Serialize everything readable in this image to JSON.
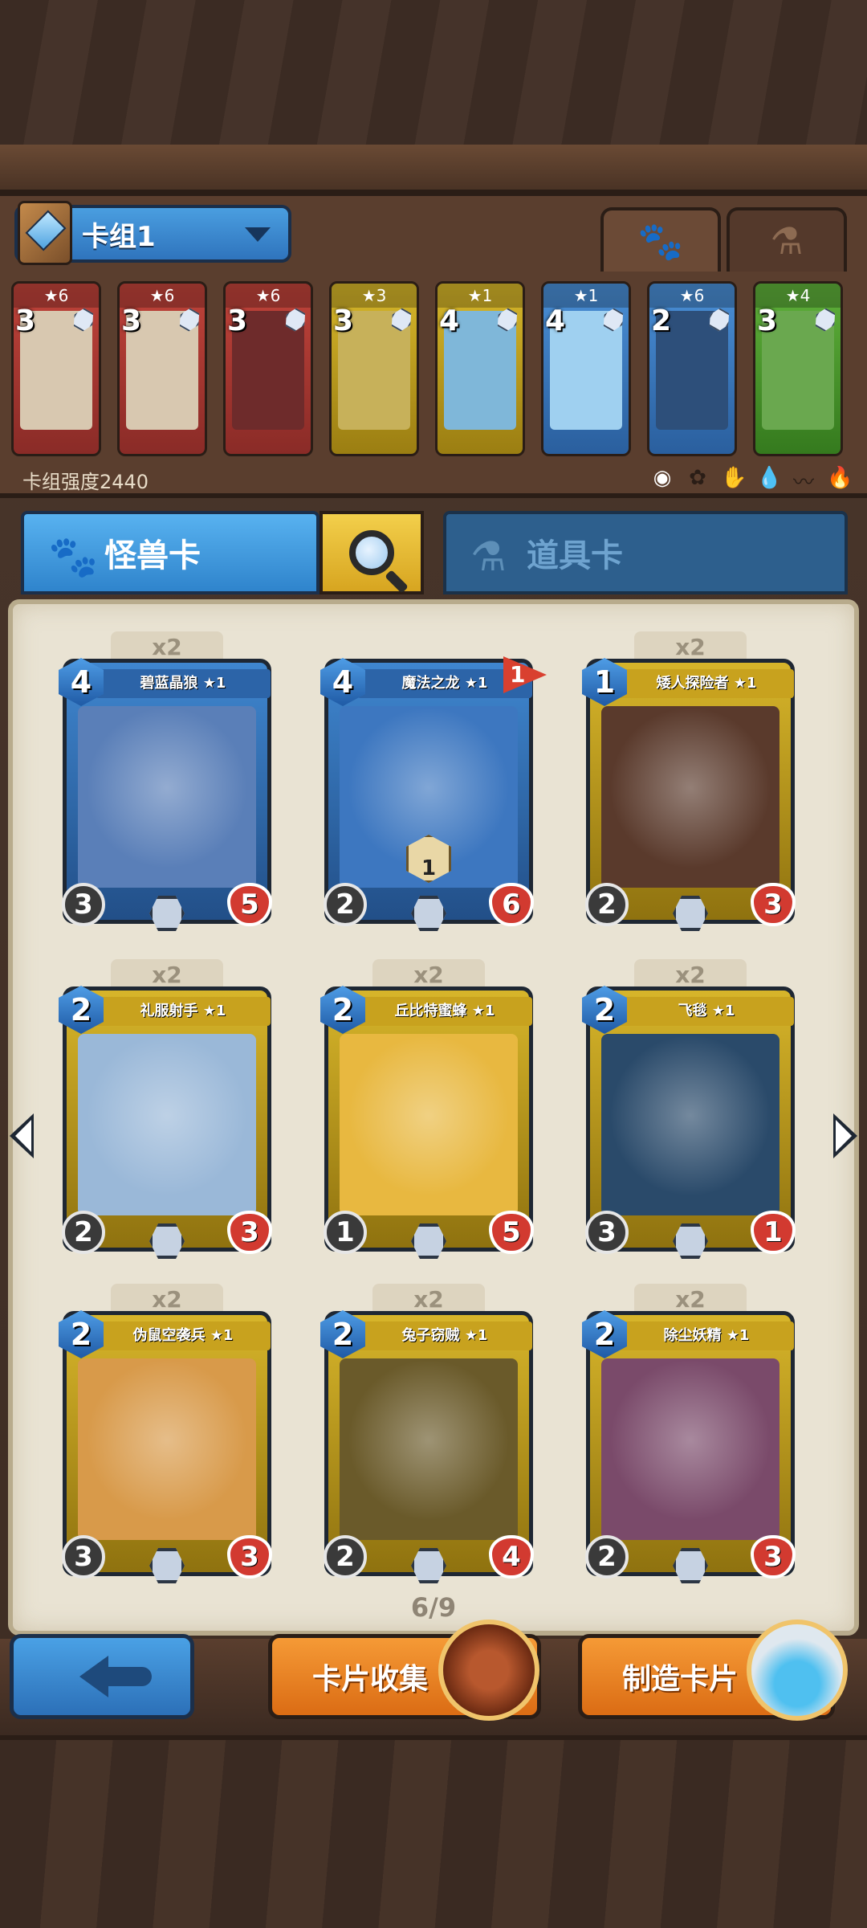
{
  "deck": {
    "title": "卡组1",
    "strength_label": "卡组强度2440",
    "cards": [
      {
        "stars": "★6",
        "cost": "3",
        "color": "red",
        "art": "#d8c8b0"
      },
      {
        "stars": "★6",
        "cost": "3",
        "color": "red",
        "art": "#d8c8b0"
      },
      {
        "stars": "★6",
        "cost": "3",
        "color": "red",
        "art": "#6e2b2b"
      },
      {
        "stars": "★3",
        "cost": "3",
        "color": "yellow",
        "art": "#c7b15a"
      },
      {
        "stars": "★1",
        "cost": "4",
        "color": "yellow",
        "art": "#7fb7d9"
      },
      {
        "stars": "★1",
        "cost": "4",
        "color": "blue",
        "art": "#9fd0f0"
      },
      {
        "stars": "★6",
        "cost": "2",
        "color": "blue",
        "art": "#2d4f7a"
      },
      {
        "stars": "★4",
        "cost": "3",
        "color": "green",
        "art": "#6aa84f"
      }
    ],
    "tabs": {
      "monster_icon": "paw-icon",
      "item_icon": "potion-icon"
    },
    "filters": [
      "all-icon",
      "element-1-icon",
      "element-2-icon",
      "water-icon",
      "wind-icon",
      "fire-icon"
    ]
  },
  "categories": {
    "monster_label": "怪兽卡",
    "item_label": "道具卡"
  },
  "collection": {
    "cards": [
      {
        "count": "x2",
        "name": "碧蓝晶狼 ★1",
        "cost": "4",
        "atk": "3",
        "hp": "5",
        "frame": "blue",
        "art": "#5a7fb8"
      },
      {
        "count": "",
        "name": "魔法之龙 ★1",
        "cost": "4",
        "atk": "2",
        "hp": "6",
        "frame": "blue",
        "art": "#3d77c0",
        "flag": "1",
        "special": "1"
      },
      {
        "count": "x2",
        "name": "矮人探险者 ★1",
        "cost": "1",
        "atk": "2",
        "hp": "3",
        "frame": "gold",
        "art": "#5a3a2c"
      },
      {
        "count": "x2",
        "name": "礼服射手 ★1",
        "cost": "2",
        "atk": "2",
        "hp": "3",
        "frame": "gold",
        "art": "#9ab8d8"
      },
      {
        "count": "x2",
        "name": "丘比特蜜蜂 ★1",
        "cost": "2",
        "atk": "1",
        "hp": "5",
        "frame": "gold",
        "art": "#e8b840"
      },
      {
        "count": "x2",
        "name": "飞毯 ★1",
        "cost": "2",
        "atk": "3",
        "hp": "1",
        "frame": "gold",
        "art": "#2a4a6a"
      },
      {
        "count": "x2",
        "name": "伪鼠空袭兵 ★1",
        "cost": "2",
        "atk": "3",
        "hp": "3",
        "frame": "gold",
        "art": "#d89a4a"
      },
      {
        "count": "x2",
        "name": "兔子窃贼 ★1",
        "cost": "2",
        "atk": "2",
        "hp": "4",
        "frame": "gold",
        "art": "#6a5a2a"
      },
      {
        "count": "x2",
        "name": "除尘妖精 ★1",
        "cost": "2",
        "atk": "2",
        "hp": "3",
        "frame": "gold",
        "art": "#7a4a6a"
      }
    ],
    "page": "6/9"
  },
  "bottom": {
    "collect_label": "卡片收集",
    "craft_label": "制造卡片"
  }
}
